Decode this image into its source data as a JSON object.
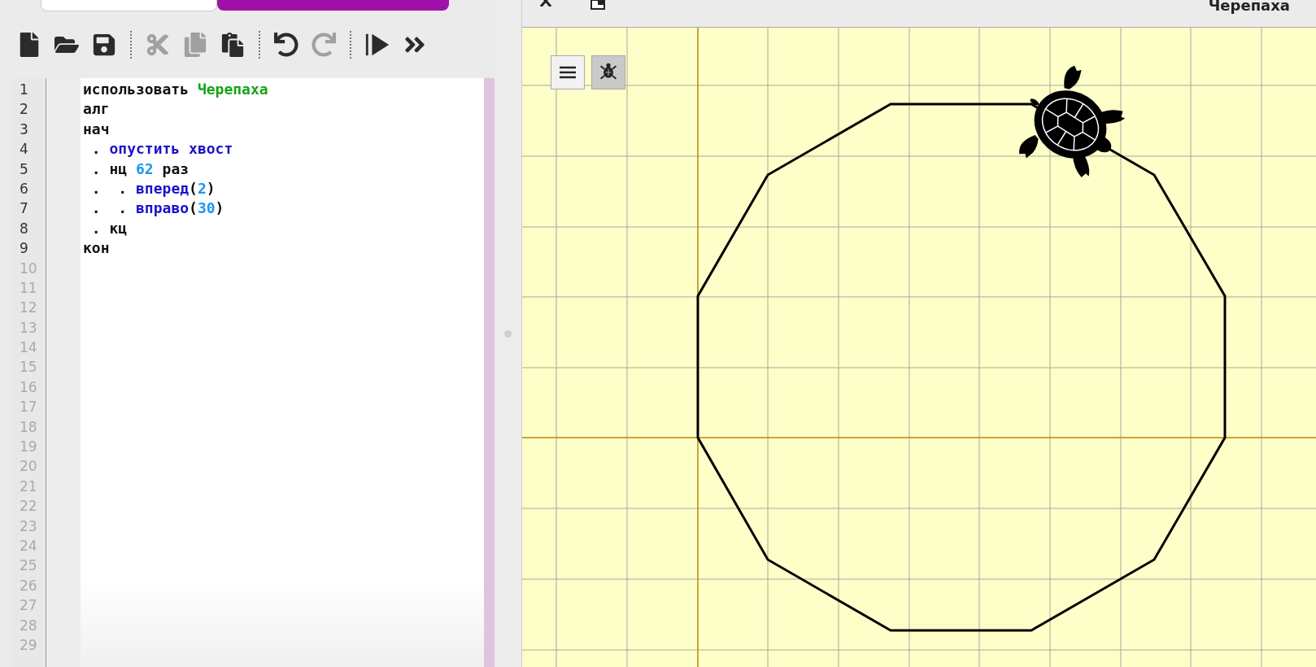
{
  "toolbar": [
    {
      "kind": "new",
      "disabled": false
    },
    {
      "kind": "open",
      "disabled": false
    },
    {
      "kind": "save",
      "disabled": false
    },
    {
      "kind": "separator"
    },
    {
      "kind": "cut",
      "disabled": true
    },
    {
      "kind": "copy",
      "disabled": true
    },
    {
      "kind": "paste",
      "disabled": false
    },
    {
      "kind": "separator"
    },
    {
      "kind": "undo",
      "disabled": false
    },
    {
      "kind": "redo",
      "disabled": true
    },
    {
      "kind": "separator"
    },
    {
      "kind": "run",
      "disabled": false
    },
    {
      "kind": "more",
      "disabled": false
    }
  ],
  "editor": {
    "line_numbers": [
      "1",
      "2",
      "3",
      "4",
      "5",
      "6",
      "7",
      "8",
      "9",
      "10",
      "11",
      "12",
      "13",
      "14",
      "15",
      "16",
      "17",
      "18",
      "19",
      "20",
      "21",
      "22",
      "23",
      "24",
      "25",
      "26",
      "27",
      "28",
      "29"
    ],
    "code_lines": [
      [
        {
          "kind": "keyword",
          "text": "использовать "
        },
        {
          "kind": "module",
          "text": "Черепаха"
        }
      ],
      [
        {
          "kind": "keyword",
          "text": "алг"
        }
      ],
      [
        {
          "kind": "keyword",
          "text": "нач"
        }
      ],
      [
        {
          "kind": "plain",
          "text": " . "
        },
        {
          "kind": "command",
          "text": "опустить хвост"
        }
      ],
      [
        {
          "kind": "plain",
          "text": " . "
        },
        {
          "kind": "keyword",
          "text": "нц "
        },
        {
          "kind": "number",
          "text": "62"
        },
        {
          "kind": "keyword",
          "text": " раз"
        }
      ],
      [
        {
          "kind": "plain",
          "text": " .  . "
        },
        {
          "kind": "command",
          "text": "вперед"
        },
        {
          "kind": "plain",
          "text": "("
        },
        {
          "kind": "number",
          "text": "2"
        },
        {
          "kind": "plain",
          "text": ")"
        }
      ],
      [
        {
          "kind": "plain",
          "text": " .  . "
        },
        {
          "kind": "command",
          "text": "вправо"
        },
        {
          "kind": "plain",
          "text": "("
        },
        {
          "kind": "number",
          "text": "30"
        },
        {
          "kind": "plain",
          "text": ")"
        }
      ],
      [
        {
          "kind": "plain",
          "text": " . "
        },
        {
          "kind": "keyword",
          "text": "кц"
        }
      ],
      [
        {
          "kind": "keyword",
          "text": "кон"
        }
      ]
    ]
  },
  "turtle_window": {
    "title": "Черепаха",
    "turtle_button": {
      "pressed": true
    }
  }
}
